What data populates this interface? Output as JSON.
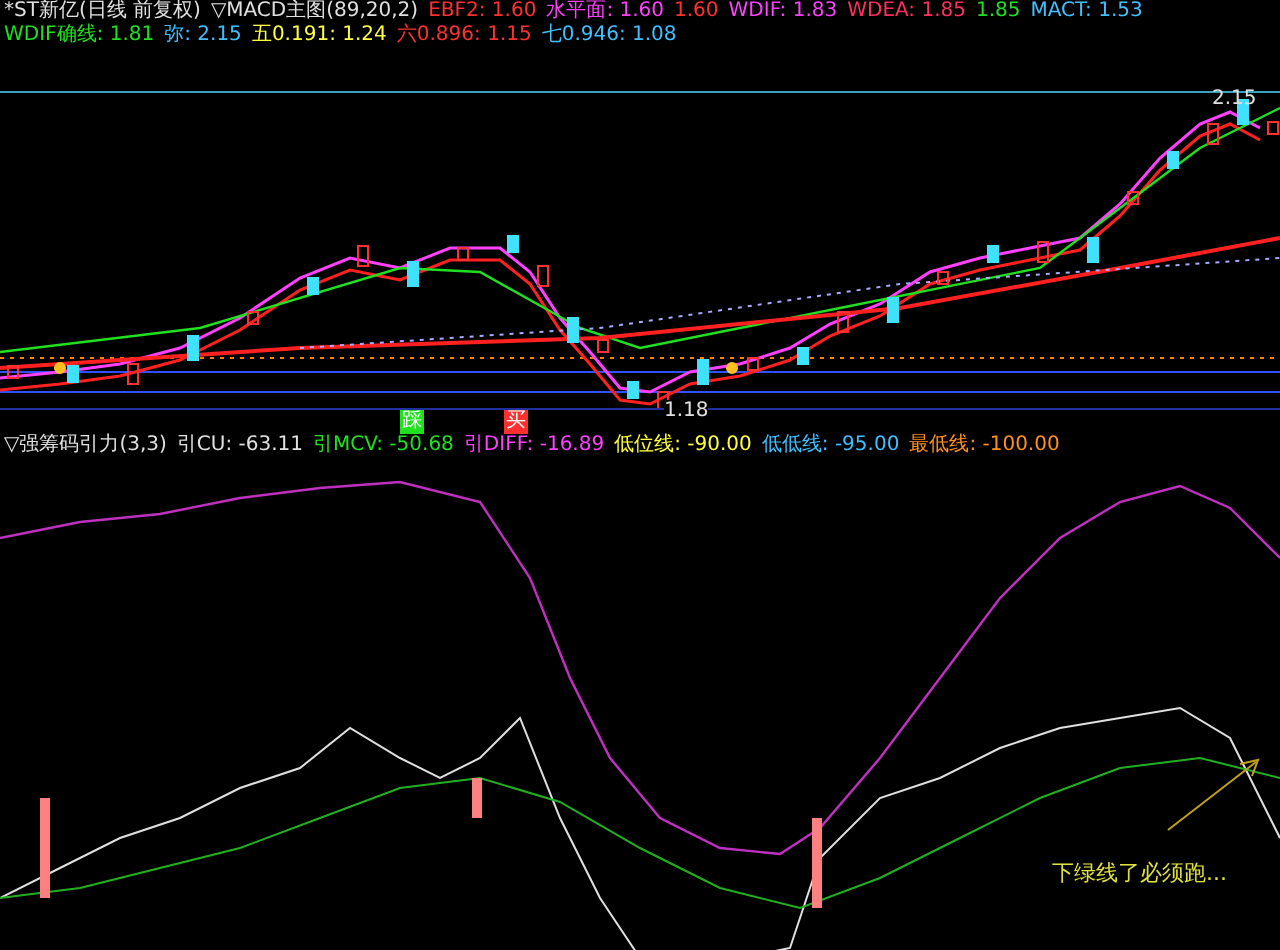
{
  "price_panel": {
    "title": "*ST新亿(日线 前复权)",
    "indicator": "▽MACD主图(89,20,2)",
    "legend": [
      {
        "text": "EBF2: 1.60",
        "color": "#ff3030"
      },
      {
        "text": "水平面: 1.60",
        "color": "#ff40ff"
      },
      {
        "text": "1.60",
        "color": "#ff3030"
      },
      {
        "text": "WDIF: 1.83",
        "color": "#ff40ff"
      },
      {
        "text": "WDEA: 1.85",
        "color": "#ff3060"
      },
      {
        "text": "1.85",
        "color": "#20e020"
      },
      {
        "text": "MACT: 1.53",
        "color": "#40c0ff"
      },
      {
        "text": "WDIF确线: 1.81",
        "color": "#20e020"
      },
      {
        "text": "弥: 2.15",
        "color": "#40c0ff"
      },
      {
        "text": "五0.191: 1.24",
        "color": "#ffff40"
      },
      {
        "text": "六0.896: 1.15",
        "color": "#ff3030"
      },
      {
        "text": "七0.946: 1.08",
        "color": "#40c0ff"
      }
    ],
    "high_label": "2.15",
    "low_label": "1.18"
  },
  "markers": [
    {
      "text": "踩",
      "color": "#20e020"
    },
    {
      "text": "买",
      "color": "#ff3030"
    }
  ],
  "indicator_panel": {
    "title": "▽强筹码引力(3,3)",
    "legend": [
      {
        "text": "引CU: -63.11",
        "color": "#e0e0e0"
      },
      {
        "text": "引MCV: -50.68",
        "color": "#20e020"
      },
      {
        "text": "引DIFF: -16.89",
        "color": "#ff40ff"
      },
      {
        "text": "低位线: -90.00",
        "color": "#ffff40"
      },
      {
        "text": "低低线: -95.00",
        "color": "#40c0ff"
      },
      {
        "text": "最低线: -100.00",
        "color": "#ff9020"
      }
    ],
    "annotation": "下绿线了必须跑..."
  }
}
